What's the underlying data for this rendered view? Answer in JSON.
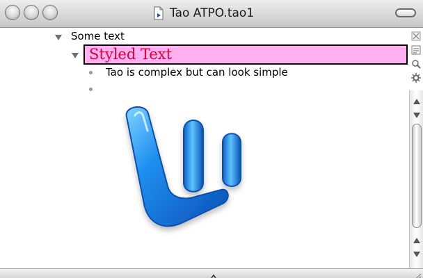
{
  "window": {
    "title": "Tao ATPO.tao1"
  },
  "outline": {
    "rows": [
      {
        "text": "Some text",
        "expanded": true
      },
      {
        "text": "Styled Text",
        "expanded": true,
        "style": {
          "background": "#ffb0f0",
          "color": "#e0003a"
        }
      },
      {
        "text": "Tao is complex but can look simple"
      },
      {
        "text": ""
      }
    ]
  },
  "image": {
    "icon": "microsoft-word-logo"
  },
  "sidebar_tools": {
    "icons": [
      "close-icon",
      "notes-icon",
      "search-icon",
      "gear-icon"
    ]
  },
  "colors": {
    "accent_highlight": "#ffb0f0",
    "accent_text": "#e0003a",
    "logo_blue": "#1e7de0"
  }
}
